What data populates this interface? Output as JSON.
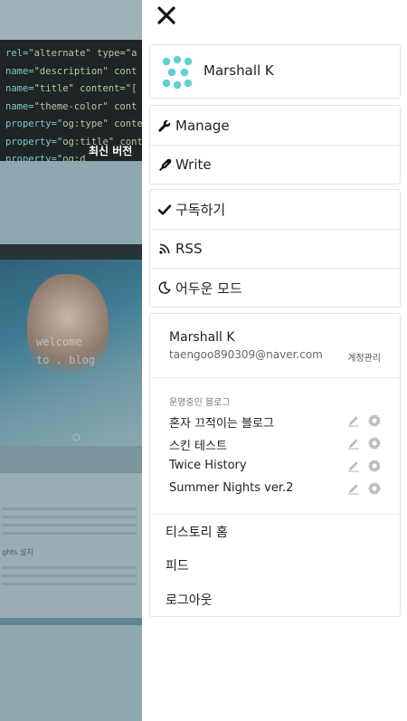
{
  "background_page": {
    "code_lines": [
      {
        "attr": "rel=",
        "value": "\"alternate\" type=\"a"
      },
      {
        "attr": "name=",
        "value": "\"description\" cont"
      },
      {
        "attr": "name=",
        "value": "\"title\" content=\"["
      },
      {
        "attr": "name=",
        "value": "\"theme-color\" cont"
      },
      {
        "attr": "property=",
        "value": "\"og:type\" conte"
      },
      {
        "attr": "property=",
        "value": "\"og:title\" conte"
      },
      {
        "attr": "property=",
        "value": "\"og:d"
      }
    ],
    "code_caption": "최신 버전",
    "hero_text": "welcome",
    "hero_text2": "to . blog",
    "article_heading": "ghts 설치"
  },
  "drawer": {
    "close_icon": "close-icon",
    "profile": {
      "name": "Marshall K",
      "logo_color": "#5fcfd1"
    },
    "manage_menu": [
      {
        "label": "Manage",
        "icon": "wrench-icon"
      },
      {
        "label": "Write",
        "icon": "pen-icon"
      }
    ],
    "subscribe_menu": [
      {
        "label": "구독하기",
        "icon": "checkmark-icon"
      },
      {
        "label": "RSS",
        "icon": "rss-icon"
      },
      {
        "label": "어두운 모드",
        "icon": "moon-icon"
      }
    ],
    "account": {
      "name": "Marshall K",
      "email": "taengoo890309@naver.com",
      "manage_label": "계정관리",
      "blogs_heading": "운영중인 블로그",
      "blogs": [
        {
          "title": "혼자 끄적이는 블로그"
        },
        {
          "title": "스킨 테스트"
        },
        {
          "title": "Twice History"
        },
        {
          "title": "Summer Nights ver.2"
        }
      ],
      "links": [
        {
          "label": "티스토리 홈"
        },
        {
          "label": "피드"
        },
        {
          "label": "로그아웃"
        }
      ]
    }
  }
}
